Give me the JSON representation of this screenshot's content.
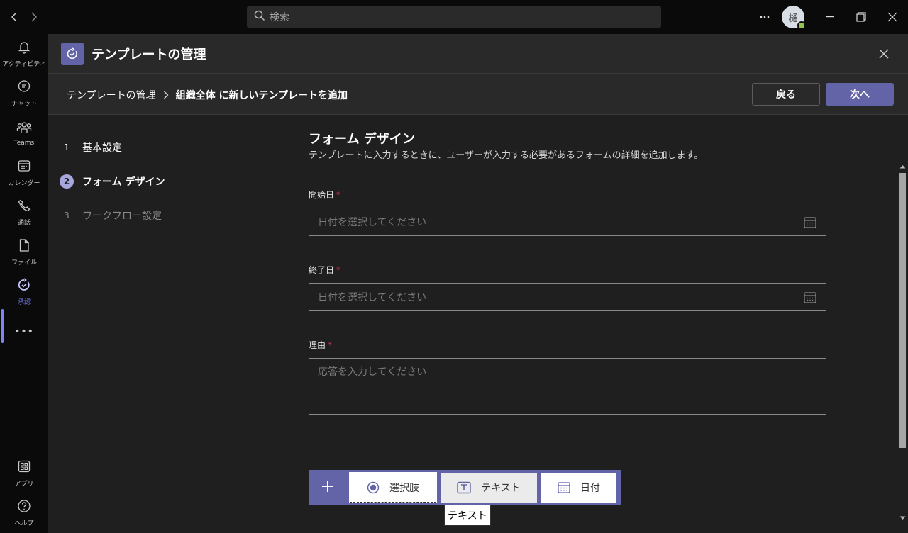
{
  "titlebar": {
    "search_placeholder": "検索",
    "avatar_initial": "樋",
    "more_label": "···"
  },
  "rail": {
    "items": [
      {
        "label": "アクティビティ",
        "icon": "bell-icon"
      },
      {
        "label": "チャット",
        "icon": "chat-icon"
      },
      {
        "label": "Teams",
        "icon": "teams-icon"
      },
      {
        "label": "カレンダー",
        "icon": "calendar-icon"
      },
      {
        "label": "通話",
        "icon": "phone-icon"
      },
      {
        "label": "ファイル",
        "icon": "file-icon"
      },
      {
        "label": "承認",
        "icon": "approvals-icon"
      },
      {
        "label": "アプリ",
        "icon": "apps-icon"
      },
      {
        "label": "ヘルプ",
        "icon": "help-icon"
      }
    ],
    "more": "•••"
  },
  "header": {
    "title": "テンプレートの管理"
  },
  "breadcrumb": {
    "parent": "テンプレートの管理",
    "current": "組織全体 に新しいテンプレートを追加"
  },
  "actions": {
    "back": "戻る",
    "next": "次へ"
  },
  "steps": [
    {
      "num": "1",
      "label": "基本設定",
      "state": "done"
    },
    {
      "num": "2",
      "label": "フォーム デザイン",
      "state": "active"
    },
    {
      "num": "3",
      "label": "ワークフロー設定",
      "state": "pending"
    }
  ],
  "form": {
    "title": "フォーム デザイン",
    "subtitle": "テンプレートに入力するときに、ユーザーが入力する必要があるフォームの詳細を追加します。",
    "fields": [
      {
        "label": "開始日",
        "required_mark": "*",
        "placeholder": "日付を選択してください"
      },
      {
        "label": "終了日",
        "required_mark": "*",
        "placeholder": "日付を選択してください"
      },
      {
        "label": "理由",
        "required_mark": "*",
        "placeholder": "応答を入力してください"
      }
    ],
    "add_options": [
      {
        "label": "選択肢",
        "icon": "radio-icon"
      },
      {
        "label": "テキスト",
        "icon": "text-icon"
      },
      {
        "label": "日付",
        "icon": "calendar-icon"
      }
    ],
    "tooltip": "テキスト"
  },
  "colors": {
    "accent": "#6264a7",
    "accent_light": "#a6a7dc",
    "required": "#c4314b",
    "presence": "#92c353"
  }
}
